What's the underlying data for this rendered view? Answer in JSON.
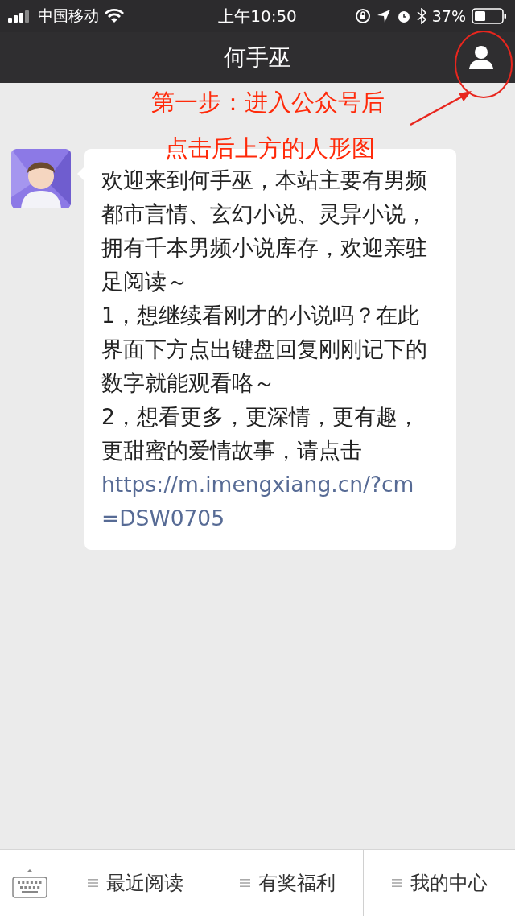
{
  "status_bar": {
    "carrier": "中国移动",
    "time": "上午10:50",
    "battery": "37%"
  },
  "nav": {
    "title": "何手巫"
  },
  "annotation": {
    "lines": [
      "第一步：进入公众号后",
      "点击后上方的人形图"
    ]
  },
  "message": {
    "paragraphs": [
      "欢迎来到何手巫，本站主要有男频都市言情、玄幻小说、灵异小说，拥有千本男频小说库存，欢迎亲驻足阅读～",
      "1，想继续看刚才的小说吗？在此界面下方点出键盘回复刚刚记下的数字就能观看咯～",
      "2，想看更多，更深情，更有趣，更甜蜜的爱情故事，请点击"
    ],
    "link": "https://m.imengxiang.cn/?cm=DSW0705"
  },
  "menu": [
    {
      "label": "最近阅读"
    },
    {
      "label": "有奖福利"
    },
    {
      "label": "我的中心"
    }
  ]
}
